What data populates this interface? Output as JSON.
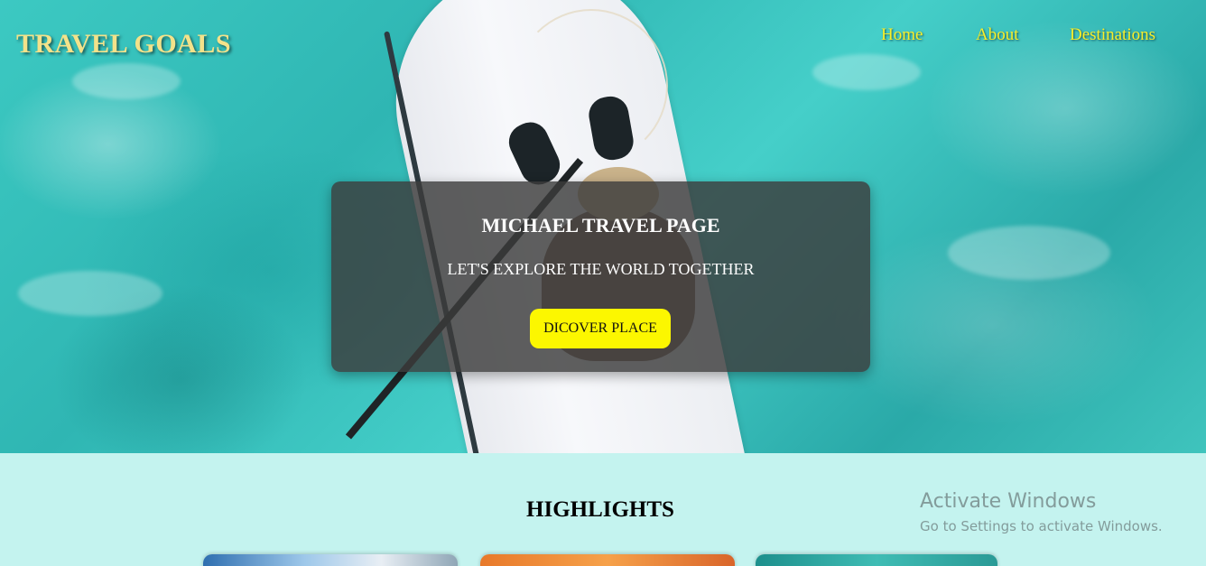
{
  "header": {
    "logo": "TRAVEL GOALS",
    "nav": [
      "Home",
      "About",
      "Destinations"
    ]
  },
  "hero": {
    "title": "MICHAEL TRAVEL PAGE",
    "subtitle": "LET'S EXPLORE THE WORLD TOGETHER",
    "cta_label": "DICOVER PLACE"
  },
  "highlights": {
    "title": "HIGHLIGHTS"
  },
  "watermark": {
    "title": "Activate Windows",
    "subtitle": "Go to Settings to activate Windows."
  },
  "colors": {
    "logo": "#f3e28a",
    "nav": "#f8ef2a",
    "cta": "#fcf700",
    "section_bg": "#c4f3ef"
  }
}
